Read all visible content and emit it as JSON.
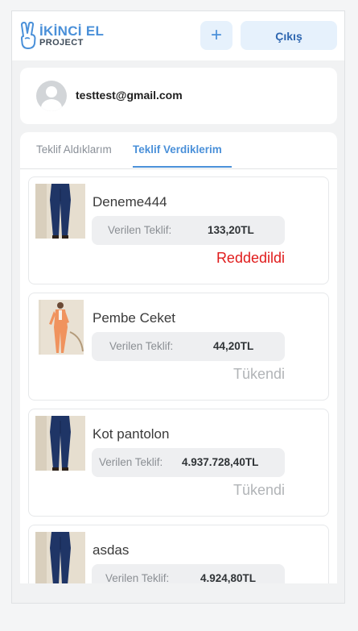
{
  "header": {
    "logo_main": "İKİNCİ EL",
    "logo_sub": "PROJECT",
    "add_label": "+",
    "exit_label": "Çıkış"
  },
  "user": {
    "email": "testtest@gmail.com"
  },
  "tabs": [
    {
      "label": "Teklif Aldıklarım",
      "active": false
    },
    {
      "label": "Teklif Verdiklerim",
      "active": true
    }
  ],
  "offers": [
    {
      "name": "Deneme444",
      "offer_label": "Verilen Teklif:",
      "offer_value": "133,20TL",
      "status": "Reddedildi",
      "status_type": "rejected",
      "image": "jeans-photo"
    },
    {
      "name": "Pembe Ceket",
      "offer_label": "Verilen Teklif:",
      "offer_value": "44,20TL",
      "status": "Tükendi",
      "status_type": "soldout",
      "image": "pink-jacket-photo"
    },
    {
      "name": "Kot pantolon",
      "offer_label": "Verilen Teklif:",
      "offer_value": "4.937.728,40TL",
      "status": "Tükendi",
      "status_type": "soldout",
      "image": "jeans-photo"
    },
    {
      "name": "asdas",
      "offer_label": "Verilen Teklif:",
      "offer_value": "4.924,80TL",
      "status": "",
      "status_type": "none",
      "image": "jeans-photo"
    }
  ],
  "colors": {
    "accent": "#4a90d9",
    "rejected": "#e01b1b",
    "soldout": "#b1b4b7"
  }
}
